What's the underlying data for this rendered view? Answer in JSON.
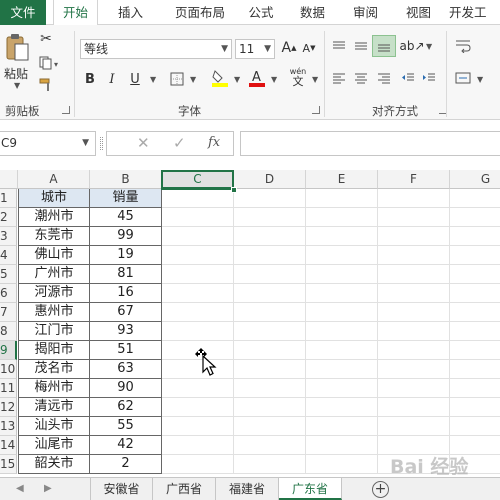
{
  "ribbon_tabs": [
    "文件",
    "开始",
    "插入",
    "页面布局",
    "公式",
    "数据",
    "审阅",
    "视图",
    "开发工"
  ],
  "active_tab": "开始",
  "clipboard": {
    "paste_label": "粘贴",
    "group_label": "剪贴板"
  },
  "font": {
    "name": "等线",
    "size": "11",
    "bold": "B",
    "italic": "I",
    "underline": "U",
    "group_label": "字体",
    "grow": "A",
    "shrink": "A",
    "phonetic_top": "wén",
    "phonetic_bottom": "文"
  },
  "align": {
    "group_label": "对齐方式"
  },
  "name_box": "C9",
  "formula_icon": "fx",
  "columns": [
    "A",
    "B",
    "C",
    "D",
    "E",
    "F",
    "G"
  ],
  "selected_column": "C",
  "row_numbers": [
    "1",
    "2",
    "3",
    "4",
    "5",
    "6",
    "7",
    "8",
    "9",
    "10",
    "11",
    "12",
    "13",
    "14",
    "15"
  ],
  "selected_row": "9",
  "table": {
    "headers": [
      "城市",
      "销量"
    ],
    "rows": [
      [
        "潮州市",
        "45"
      ],
      [
        "东莞市",
        "99"
      ],
      [
        "佛山市",
        "19"
      ],
      [
        "广州市",
        "81"
      ],
      [
        "河源市",
        "16"
      ],
      [
        "惠州市",
        "67"
      ],
      [
        "江门市",
        "93"
      ],
      [
        "揭阳市",
        "51"
      ],
      [
        "茂名市",
        "63"
      ],
      [
        "梅州市",
        "90"
      ],
      [
        "清远市",
        "62"
      ],
      [
        "汕头市",
        "55"
      ],
      [
        "汕尾市",
        "42"
      ],
      [
        "韶关市",
        "2"
      ]
    ]
  },
  "sheet_tabs": [
    "安徽省",
    "广西省",
    "福建省",
    "广东省"
  ],
  "active_sheet": "广东省",
  "add_sheet_symbol": "+",
  "watermark": "Bai 经验",
  "colors": {
    "excel_green": "#217346",
    "header_fill": "#dde7f2"
  }
}
